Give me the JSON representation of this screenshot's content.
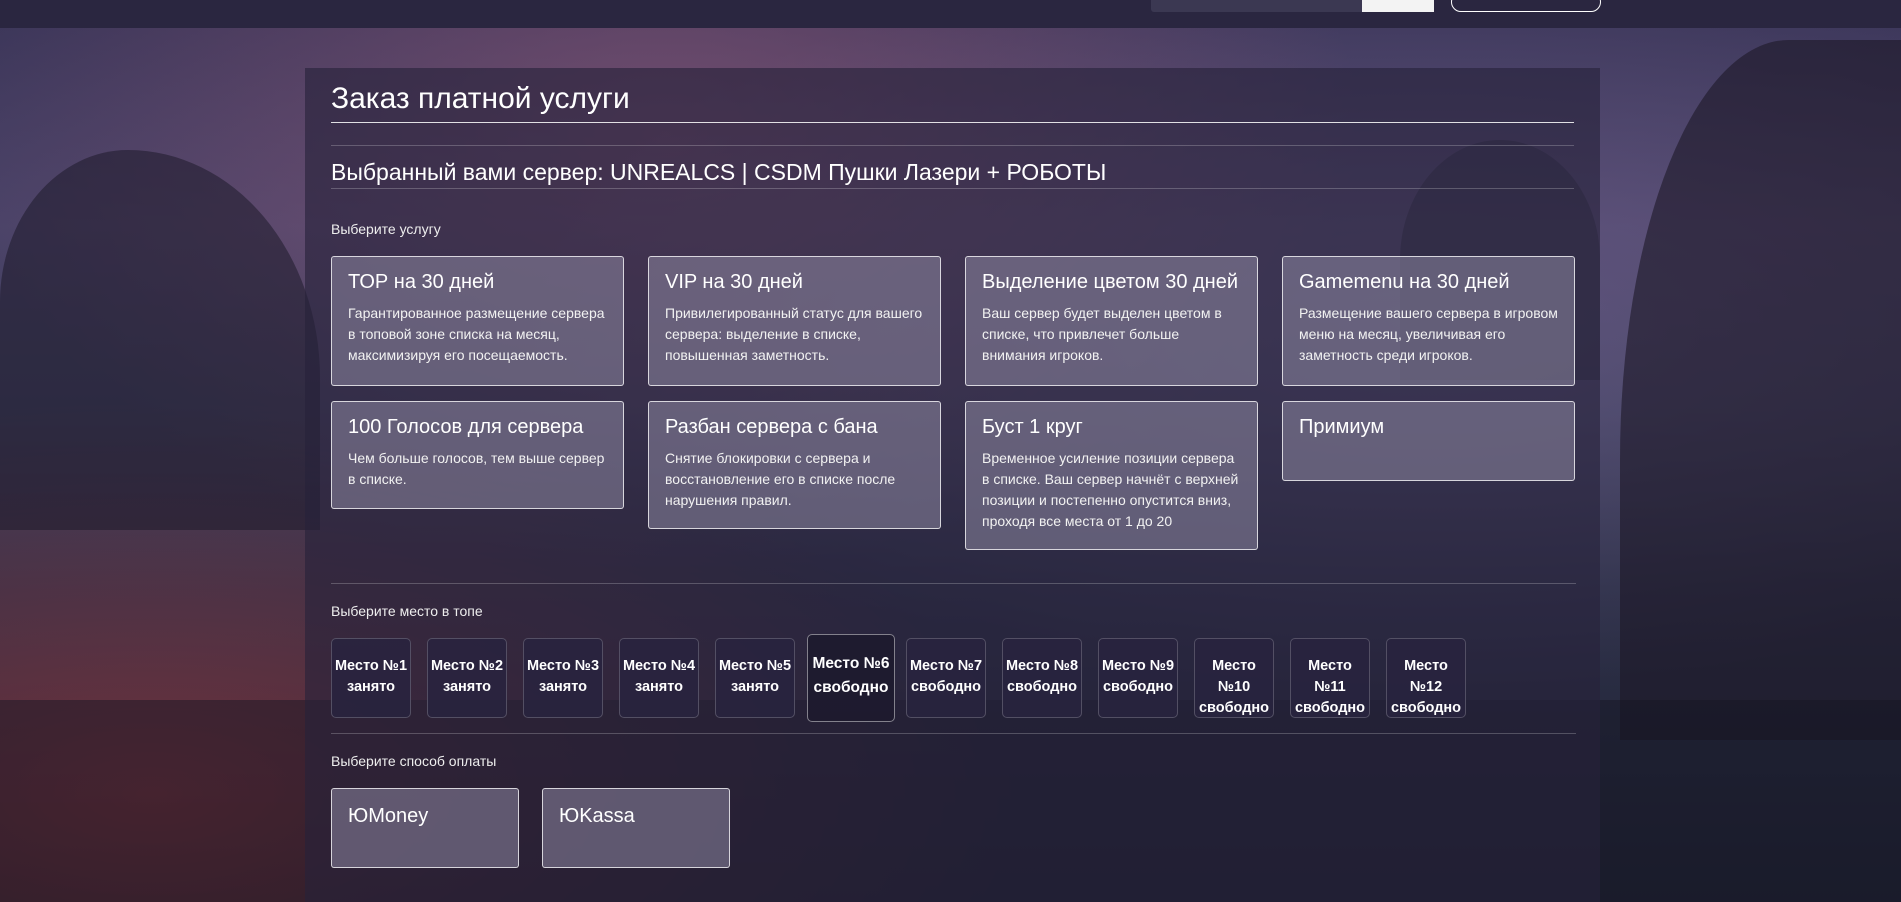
{
  "page": {
    "title": "Заказ платной услуги",
    "server_line": "Выбранный вами сервер: UNREALCS | CSDM Пушки Лазери + РОБОТЫ",
    "choose_service_label": "Выберите услугу",
    "choose_place_label": "Выберите место в топе",
    "choose_payment_label": "Выберите способ оплаты"
  },
  "services": [
    {
      "title": "ТОР на 30 дней",
      "desc": "Гарантированное размещение сервера в топовой зоне списка на месяц, максимизируя его посещаемость."
    },
    {
      "title": "VIP на 30 дней",
      "desc": "Привилегированный статус для вашего сервера: выделение в списке, повышенная заметность."
    },
    {
      "title": "Выделение цветом 30 дней",
      "desc": "Ваш сервер будет выделен цветом в списке, что привлечет больше внимания игроков."
    },
    {
      "title": "Gamemenu на 30 дней",
      "desc": "Размещение вашего сервера в игровом меню на месяц, увеличивая его заметность среди игроков."
    },
    {
      "title": "100 Голосов для сервера",
      "desc": "Чем больше голосов, тем выше сервер в списке."
    },
    {
      "title": "Разбан сервера с бана",
      "desc": "Снятие блокировки с сервера и восстановление его в списке после нарушения правил."
    },
    {
      "title": "Буст 1 круг",
      "desc": "Временное усиление позиции сервера в списке. Ваш сервер начнёт с верхней позиции и постепенно опустится вниз, проходя все места от 1 до 20"
    },
    {
      "title": "Примиум",
      "desc": ""
    }
  ],
  "places": [
    {
      "label": "Место №1",
      "status": "занято"
    },
    {
      "label": "Место №2",
      "status": "занято"
    },
    {
      "label": "Место №3",
      "status": "занято"
    },
    {
      "label": "Место №4",
      "status": "занято"
    },
    {
      "label": "Место №5",
      "status": "занято"
    },
    {
      "label": "Место №6",
      "status": "свободно"
    },
    {
      "label": "Место №7",
      "status": "свободно"
    },
    {
      "label": "Место №8",
      "status": "свободно"
    },
    {
      "label": "Место №9",
      "status": "свободно"
    },
    {
      "label": "Место №10",
      "status": "свободно"
    },
    {
      "label": "Место №11",
      "status": "свободно"
    },
    {
      "label": "Место №12",
      "status": "свободно"
    }
  ],
  "payments": [
    {
      "label": "ЮMoney"
    },
    {
      "label": "ЮKassa"
    }
  ]
}
